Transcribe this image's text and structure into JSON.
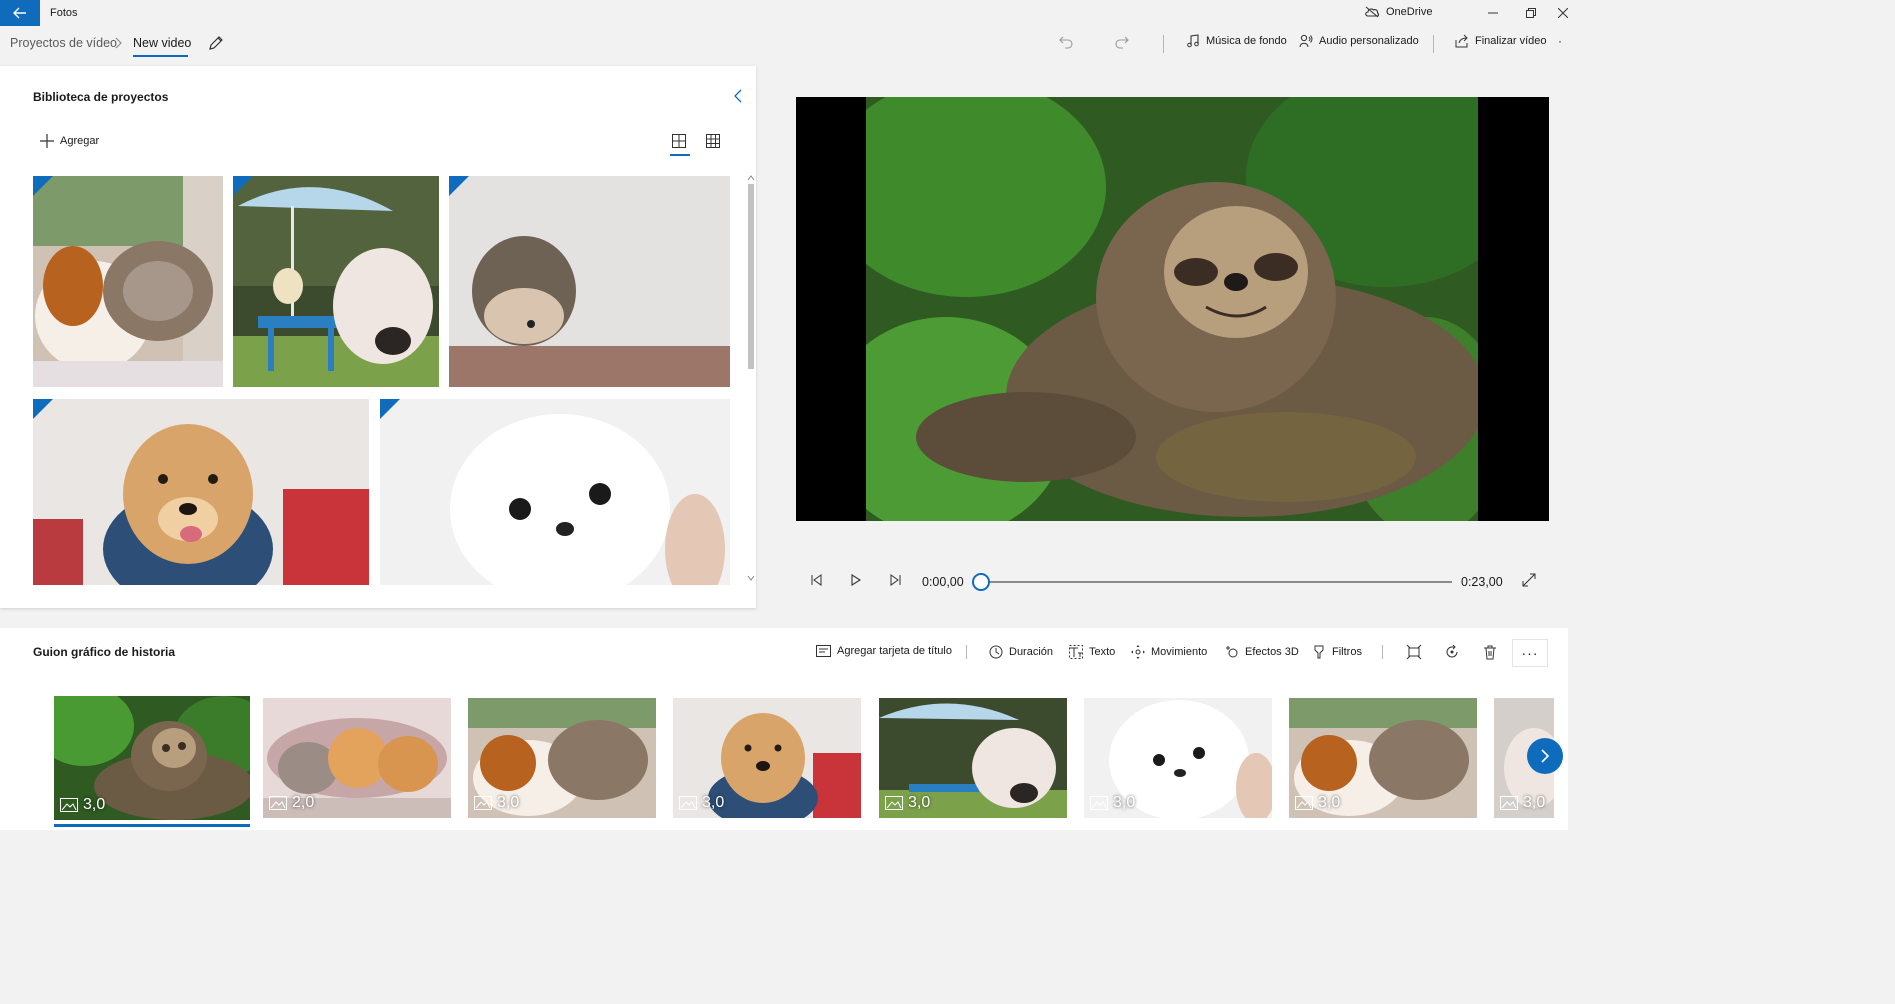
{
  "titlebar": {
    "app_name": "Fotos",
    "onedrive_label": "OneDrive"
  },
  "breadcrumb": {
    "root": "Proyectos de vídeo",
    "current": "New video"
  },
  "toolbar": {
    "background_music": "Música de fondo",
    "custom_audio": "Audio personalizado",
    "finish_video": "Finalizar vídeo"
  },
  "library": {
    "title": "Biblioteca de proyectos",
    "add_label": "Agregar"
  },
  "player": {
    "current_time": "0:00,00",
    "total_time": "0:23,00",
    "progress": 0
  },
  "storyboard": {
    "title": "Guion gráfico de historia",
    "add_title_card": "Agregar tarjeta de título",
    "duration": "Duración",
    "text": "Texto",
    "motion": "Movimiento",
    "effects_3d": "Efectos 3D",
    "filters": "Filtros",
    "clips": [
      {
        "subject": "sloth",
        "duration": "3,0"
      },
      {
        "subject": "kittens",
        "duration": "2,0"
      },
      {
        "subject": "guinea-pig-and-cat",
        "duration": "3,0"
      },
      {
        "subject": "puppy",
        "duration": "3,0"
      },
      {
        "subject": "piglet",
        "duration": "3,0"
      },
      {
        "subject": "white-dog",
        "duration": "3,0"
      },
      {
        "subject": "guinea-pig-and-cat",
        "duration": "3,0"
      },
      {
        "subject": "partial-clip",
        "duration": "3,0"
      }
    ]
  },
  "colors": {
    "accent": "#0f6cbd",
    "background": "#f2f2f2"
  }
}
